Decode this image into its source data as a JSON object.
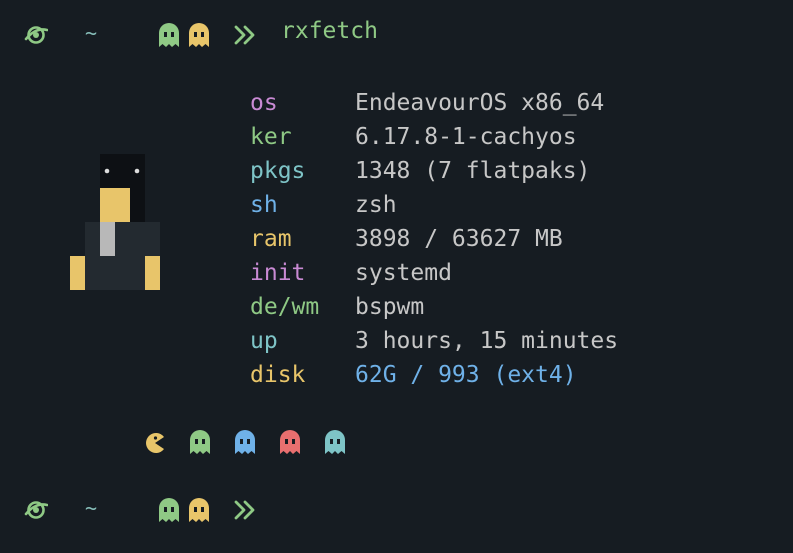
{
  "colors": {
    "background": "#161c22",
    "green": "#8fc985",
    "yellow": "#e8c56a",
    "blue": "#6fb1e8",
    "red": "#e86f6f",
    "cyan": "#7ec4c7",
    "magenta": "#c98ad4",
    "text": "#c7c7c7"
  },
  "prompt_top": {
    "icon": "atom-icon",
    "tilde": "~",
    "ghosts": [
      "ghost-icon-green",
      "ghost-icon-yellow"
    ],
    "arrow": "double-chevron-right-icon",
    "command": "rxfetch"
  },
  "info": [
    {
      "key": "os",
      "value": "EndeavourOS x86_64",
      "key_color": "#c98ad4",
      "value_color": "#c7c7c7"
    },
    {
      "key": "ker",
      "value": "6.17.8-1-cachyos",
      "key_color": "#8fc985",
      "value_color": "#c7c7c7"
    },
    {
      "key": "pkgs",
      "value": "1348 (7 flatpaks)",
      "key_color": "#7ec4c7",
      "value_color": "#c7c7c7"
    },
    {
      "key": "sh",
      "value": "zsh",
      "key_color": "#6fb1e8",
      "value_color": "#c7c7c7"
    },
    {
      "key": "ram",
      "value": "3898 / 63627 MB",
      "key_color": "#e8c56a",
      "value_color": "#c7c7c7"
    },
    {
      "key": "init",
      "value": "systemd",
      "key_color": "#c98ad4",
      "value_color": "#c7c7c7"
    },
    {
      "key": "de/wm",
      "value": "bspwm",
      "key_color": "#8fc985",
      "value_color": "#c7c7c7"
    },
    {
      "key": "up",
      "value": "3 hours, 15 minutes",
      "key_color": "#7ec4c7",
      "value_color": "#c7c7c7"
    },
    {
      "key": "disk",
      "value": "62G / 993 (ext4)",
      "key_color": "#e8c56a",
      "value_color": "#6fb1e8"
    }
  ],
  "palette": [
    {
      "icon": "pacman-icon",
      "color": "#e8c56a"
    },
    {
      "icon": "ghost-icon",
      "color": "#8fc985"
    },
    {
      "icon": "ghost-icon",
      "color": "#6fb1e8"
    },
    {
      "icon": "ghost-icon",
      "color": "#e86f6f"
    },
    {
      "icon": "ghost-icon",
      "color": "#7ec4c7"
    }
  ],
  "prompt_bottom": {
    "icon": "atom-icon",
    "tilde": "~",
    "ghosts": [
      "ghost-icon-green",
      "ghost-icon-yellow"
    ],
    "arrow": "double-chevron-right-icon"
  }
}
